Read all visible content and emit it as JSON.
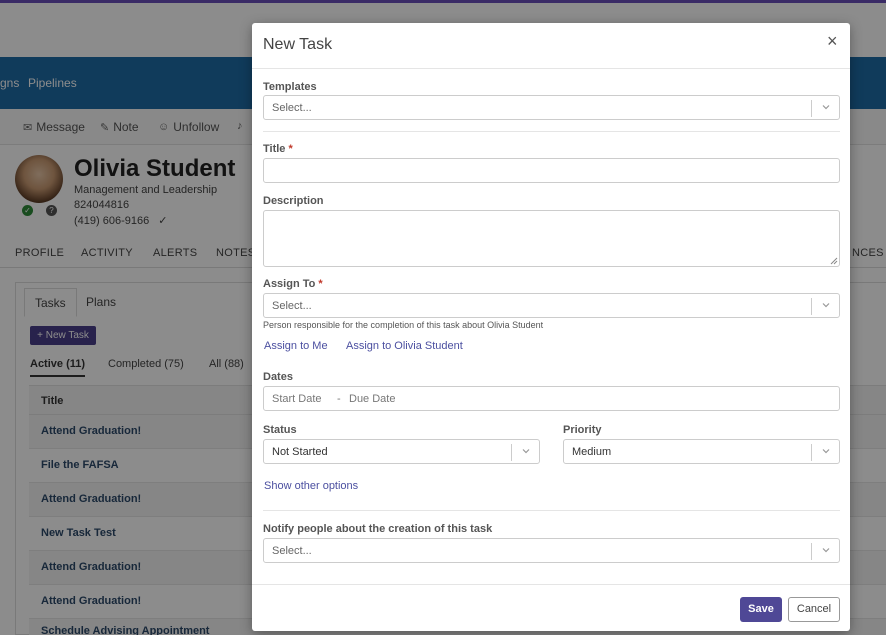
{
  "background": {
    "nav": {
      "campaigns_fragment": "gns",
      "pipelines": "Pipelines"
    },
    "actions": {
      "message": "Message",
      "note": "Note",
      "unfollow": "Unfollow"
    },
    "profile": {
      "name": "Olivia Student",
      "program": "Management and Leadership",
      "id": "824044816",
      "phone": "(419) 606-9166",
      "phone_check": "✓"
    },
    "tabs": [
      "PROFILE",
      "ACTIVITY",
      "ALERTS",
      "NOTES"
    ],
    "tabs_right_fragment": "NCES",
    "subtabs": {
      "tasks": "Tasks",
      "plans": "Plans"
    },
    "new_task_button": "New Task",
    "filters": {
      "active": "Active (11)",
      "completed": "Completed (75)",
      "all": "All (88)"
    },
    "table_header": "Title",
    "rows": [
      "Attend Graduation!",
      "File the FAFSA",
      "Attend Graduation!",
      "New Task Test",
      "Attend Graduation!",
      "Attend Graduation!",
      "Schedule Advising Appointment"
    ]
  },
  "modal": {
    "title": "New Task",
    "close": "×",
    "templates": {
      "label": "Templates",
      "placeholder": "Select..."
    },
    "title_field": {
      "label": "Title",
      "required": "*",
      "value": ""
    },
    "description": {
      "label": "Description",
      "value": ""
    },
    "assign_to": {
      "label": "Assign To",
      "required": "*",
      "placeholder": "Select...",
      "help": "Person responsible for the completion of this task about Olivia Student",
      "assign_me": "Assign to Me",
      "assign_student": "Assign to Olivia Student"
    },
    "dates": {
      "label": "Dates",
      "start": "Start Date",
      "dash": "-",
      "due": "Due Date"
    },
    "status": {
      "label": "Status",
      "value": "Not Started"
    },
    "priority": {
      "label": "Priority",
      "value": "Medium"
    },
    "show_other_options": "Show other options",
    "notify": {
      "label": "Notify people about the creation of this task",
      "placeholder": "Select..."
    },
    "save": "Save",
    "cancel": "Cancel"
  },
  "colors": {
    "accent": "#4f4896",
    "nav": "#1e6ca7",
    "top_line": "#6b4fbb",
    "link": "#4b4fa0",
    "required": "#c0392b"
  }
}
